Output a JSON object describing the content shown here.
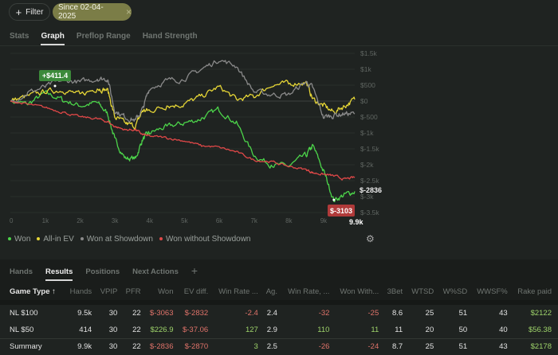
{
  "toolbar": {
    "filter_label": "Filter",
    "filter_chip": "Since 02-04-2025"
  },
  "tabs": [
    "Stats",
    "Graph",
    "Preflop Range",
    "Hand Strength"
  ],
  "active_tab": "Graph",
  "chart_data": {
    "type": "line",
    "xlabel": "Hands",
    "ylabel": "",
    "x_ticks": [
      "0",
      "1k",
      "2k",
      "3k",
      "4k",
      "5k",
      "6k",
      "7k",
      "8k",
      "9k"
    ],
    "y_ticks": [
      "$1.5k",
      "$1k",
      "$500",
      "$0",
      "$-500",
      "$-1k",
      "$-1.5k",
      "$-2k",
      "$-2.5k",
      "$-3k",
      "$-3.5k"
    ],
    "xlim": [
      0,
      9900
    ],
    "ylim": [
      -3600,
      1500
    ],
    "x": [
      0,
      500,
      1000,
      1500,
      2000,
      2500,
      2800,
      3000,
      3300,
      3600,
      3800,
      4000,
      4500,
      5000,
      5500,
      6000,
      6500,
      7000,
      7500,
      8000,
      8500,
      8700,
      9000,
      9300,
      9600,
      9900
    ],
    "series": [
      {
        "name": "Won",
        "color": "#4cd44a",
        "values": [
          0,
          -100,
          250,
          50,
          -150,
          -50,
          -400,
          -1200,
          -1800,
          -1800,
          -1200,
          -1000,
          -800,
          -700,
          -550,
          -250,
          -700,
          -1700,
          -2000,
          -2050,
          -1700,
          -1400,
          -2200,
          -3103,
          -2950,
          -2836
        ]
      },
      {
        "name": "All-in EV",
        "color": "#e6d636",
        "values": [
          0,
          150,
          300,
          350,
          200,
          400,
          350,
          -500,
          -700,
          -800,
          -300,
          -300,
          -150,
          -100,
          150,
          450,
          50,
          150,
          500,
          550,
          600,
          50,
          -150,
          -350,
          -150,
          50
        ]
      },
      {
        "name": "Won at Showdown",
        "color": "#8a8a8a",
        "values": [
          0,
          250,
          450,
          650,
          600,
          700,
          700,
          -300,
          -500,
          -600,
          -250,
          400,
          650,
          700,
          1000,
          1300,
          1100,
          300,
          200,
          200,
          600,
          400,
          -500,
          -450,
          -400,
          -400
        ]
      },
      {
        "name": "Won without Showdown",
        "color": "#e04848",
        "values": [
          0,
          -100,
          -200,
          -350,
          -500,
          -550,
          -650,
          -800,
          -900,
          -900,
          -1050,
          -1100,
          -1150,
          -1250,
          -1400,
          -1450,
          -1600,
          -1850,
          -1900,
          -2050,
          -2150,
          -2250,
          -2300,
          -2350,
          -2450,
          -2400
        ]
      }
    ],
    "annotations": {
      "max_label": "+$411.4",
      "min_label": "$-3103",
      "end_label": "$-2836",
      "end_x_label": "9.9k"
    }
  },
  "legend": [
    "Won",
    "All-in EV",
    "Won at Showdown",
    "Won without Showdown"
  ],
  "bottom_tabs": [
    "Hands",
    "Results",
    "Positions",
    "Next Actions"
  ],
  "active_bottom_tab": "Results",
  "table": {
    "headers": [
      "Game Type ↑",
      "Hands",
      "VPIP",
      "PFR",
      "Won",
      "EV diff.",
      "Win Rate ...",
      "Ag.",
      "Win Rate, ...",
      "Won With...",
      "3Bet",
      "WTSD",
      "W%SD",
      "WWSF%",
      "Rake paid"
    ],
    "rows": [
      [
        "NL $100",
        "9.5k",
        "30",
        "22",
        "$-3063",
        "$-2832",
        "-2.4",
        "2.4",
        "-32",
        "-25",
        "8.6",
        "25",
        "51",
        "43",
        "$2122"
      ],
      [
        "NL $50",
        "414",
        "30",
        "22",
        "$226.9",
        "$-37.06",
        "127",
        "2.9",
        "110",
        "11",
        "11",
        "20",
        "50",
        "40",
        "$56.38"
      ],
      [
        "Summary",
        "9.9k",
        "30",
        "22",
        "$-2836",
        "$-2870",
        "3",
        "2.5",
        "-26",
        "-24",
        "8.7",
        "25",
        "51",
        "43",
        "$2178"
      ]
    ]
  }
}
